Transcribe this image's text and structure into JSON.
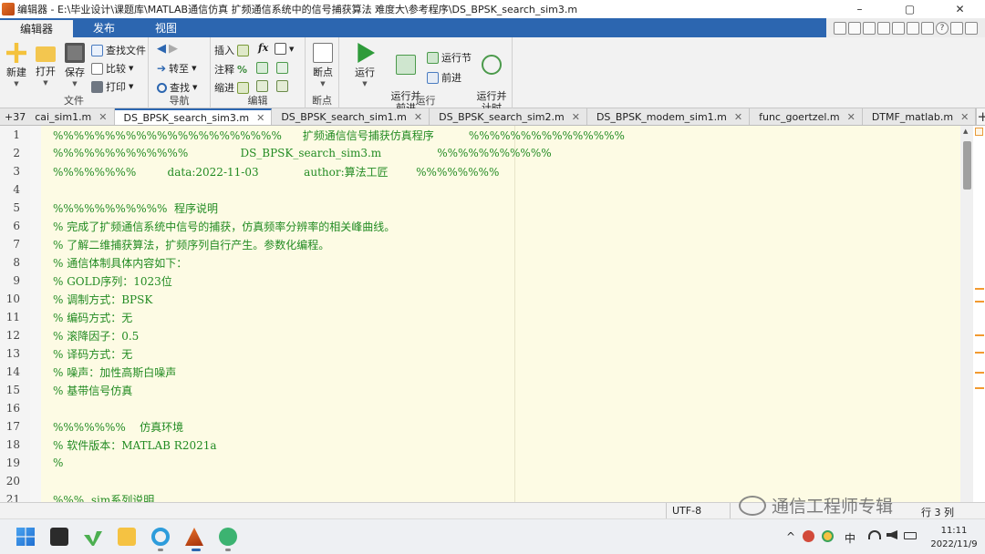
{
  "window": {
    "title": "编辑器 - E:\\毕业设计\\课题库\\MATLAB通信仿真 扩频通信系统中的信号捕获算法 难度大\\参考程序\\DS_BPSK_search_sim3.m",
    "minimize": "–",
    "maximize": "▢",
    "close": "✕"
  },
  "ribbon_tabs": [
    {
      "label": "编辑器",
      "active": true
    },
    {
      "label": "发布",
      "active": false
    },
    {
      "label": "视图",
      "active": false
    }
  ],
  "quick_access": {
    "help": "?"
  },
  "ribbon": {
    "file": {
      "label": "文件",
      "new": "新建",
      "open": "打开",
      "save": "保存",
      "find_files": "查找文件",
      "compare": "比较",
      "print": "打印"
    },
    "nav": {
      "label": "导航",
      "goto": "转至",
      "find": "查找"
    },
    "edit": {
      "label": "编辑",
      "insert": "插入",
      "comment": "注释",
      "indent": "缩进",
      "fx": "fx",
      "percent": "%"
    },
    "breakpoints": {
      "label": "断点",
      "breakpoints": "断点"
    },
    "run": {
      "label": "运行",
      "run": "运行",
      "run_advance": "运行并\n前进",
      "run_section": "运行节",
      "advance": "前进",
      "run_time": "运行并\n计时"
    }
  },
  "doc_tabs": {
    "overflow": "+37",
    "tabs": [
      {
        "label": "cai_sim1.m",
        "active": false
      },
      {
        "label": "DS_BPSK_search_sim3.m",
        "active": true
      },
      {
        "label": "DS_BPSK_search_sim1.m",
        "active": false
      },
      {
        "label": "DS_BPSK_search_sim2.m",
        "active": false
      },
      {
        "label": "DS_BPSK_modem_sim1.m",
        "active": false
      },
      {
        "label": "func_goertzel.m",
        "active": false
      },
      {
        "label": "DTMF_matlab.m",
        "active": false
      }
    ],
    "add": "+"
  },
  "code_lines": [
    {
      "n": "1",
      "text": "%%%%%%%%%%%%%%%%%%%%%%      扩频通信信号捕获仿真程序          %%%%%%%%%%%%%%%"
    },
    {
      "n": "2",
      "text": "%%%%%%%%%%%%%               DS_BPSK_search_sim3.m                %%%%%%%%%%%"
    },
    {
      "n": "3",
      "text": "%%%%%%%%         data:2022-11-03             author:算法工匠        %%%%%%%%"
    },
    {
      "n": "4",
      "text": ""
    },
    {
      "n": "5",
      "text": "%%%%%%%%%%%  程序说明"
    },
    {
      "n": "6",
      "text": "% 完成了扩频通信系统中信号的捕获，仿真频率分辨率的相关峰曲线。"
    },
    {
      "n": "7",
      "text": "% 了解二维捕获算法，扩频序列自行产生。参数化编程。"
    },
    {
      "n": "8",
      "text": "% 通信体制具体内容如下："
    },
    {
      "n": "9",
      "text": "% GOLD序列：1023位"
    },
    {
      "n": "10",
      "text": "% 调制方式：BPSK"
    },
    {
      "n": "11",
      "text": "% 编码方式：无"
    },
    {
      "n": "12",
      "text": "% 滚降因子：0.5"
    },
    {
      "n": "13",
      "text": "% 译码方式：无"
    },
    {
      "n": "14",
      "text": "% 噪声：加性高斯白噪声"
    },
    {
      "n": "15",
      "text": "% 基带信号仿真"
    },
    {
      "n": "16",
      "text": ""
    },
    {
      "n": "17",
      "text": "%%%%%%%    仿真环境"
    },
    {
      "n": "18",
      "text": "% 软件版本：MATLAB R2021a"
    },
    {
      "n": "19",
      "text": "%"
    },
    {
      "n": "20",
      "text": ""
    },
    {
      "n": "21",
      "text": "%%%  sim系列说明"
    }
  ],
  "status": {
    "encoding": "UTF-8",
    "position": "行 3 列"
  },
  "watermark": "通信工程师专辑",
  "taskbar": {
    "tray_lang": "中",
    "time": "11:11",
    "date": "2022/11/9",
    "chevron": "^"
  },
  "colors": {
    "accent": "#2c66b0",
    "code_bg": "#fdfbe4",
    "comment": "#228b22"
  }
}
